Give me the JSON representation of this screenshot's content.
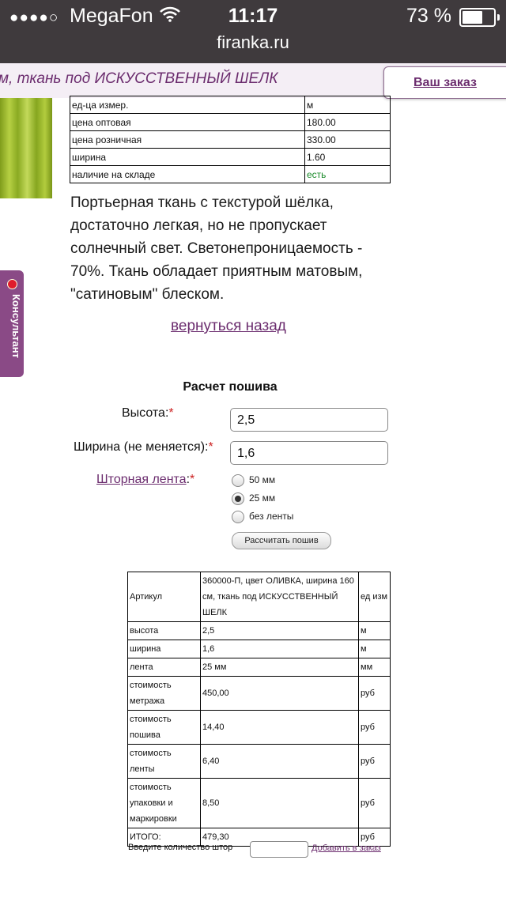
{
  "status_bar": {
    "signal": "●●●●○",
    "carrier": "MegaFon",
    "time": "11:17",
    "battery_percent": "73 %",
    "battery_level": 0.73,
    "url": "firanka.ru"
  },
  "header": {
    "title": "м, ткань под ИСКУССТВЕННЫЙ ШЕЛК",
    "order_link": "Ваш заказ"
  },
  "spec_table": [
    {
      "key": "ед-ца измер.",
      "value": "м"
    },
    {
      "key": "цена оптовая",
      "value": "180.00"
    },
    {
      "key": "цена розничная",
      "value": "330.00"
    },
    {
      "key": "ширина",
      "value": "1.60"
    },
    {
      "key": "наличие на складе",
      "value": "есть"
    }
  ],
  "description": "Портьерная ткань с текстурой шёлка, достаточно легкая, но не пропускает солнечный свет. Светонепроницаемость - 70%. Ткань обладает приятным матовым, \"сатиновым\" блеском.",
  "back_link": "вернуться назад",
  "consultant": {
    "label": "Консультант"
  },
  "calculator": {
    "title": "Расчет пошива",
    "height_label": "Высота:",
    "height_value": "2,5",
    "width_label": "Ширина (не меняется):",
    "width_value": "1,6",
    "tape_label": "Шторная лента",
    "colon": ":",
    "required_mark": "*",
    "tape_options": [
      "50 мм",
      "25 мм",
      "без ленты"
    ],
    "tape_selected": "25 мм",
    "calc_button": "Рассчитать пошив"
  },
  "result_table": {
    "header": [
      "Артикул",
      "360000-П, цвет ОЛИВКА, ширина 160 см, ткань под ИСКУССТВЕННЫЙ ШЕЛК",
      "ед изм"
    ],
    "rows": [
      [
        "высота",
        "2,5",
        "м"
      ],
      [
        "ширина",
        "1,6",
        "м"
      ],
      [
        "лента",
        "25 мм",
        "мм"
      ],
      [
        "стоимость метража",
        "450,00",
        "руб"
      ],
      [
        "стоимость пошива",
        "14,40",
        "руб"
      ],
      [
        "стоимость ленты",
        "6,40",
        "руб"
      ],
      [
        "стоимость упаковки и маркировки",
        "8,50",
        "руб"
      ],
      [
        "ИТОГО:",
        "479,30",
        "руб"
      ]
    ]
  },
  "order": {
    "quantity_label": "Введите количество штор",
    "quantity_value": "",
    "add_link": "Добавить в заказ"
  },
  "colors": {
    "status_bar_bg": "#3f3a3d",
    "accent_purple": "#6b2c6e",
    "consultant_bg": "#8a4a86",
    "required_red": "#cc2222",
    "in_stock_green": "#1a8a2a",
    "fabric_olive": "#9dba2e"
  }
}
